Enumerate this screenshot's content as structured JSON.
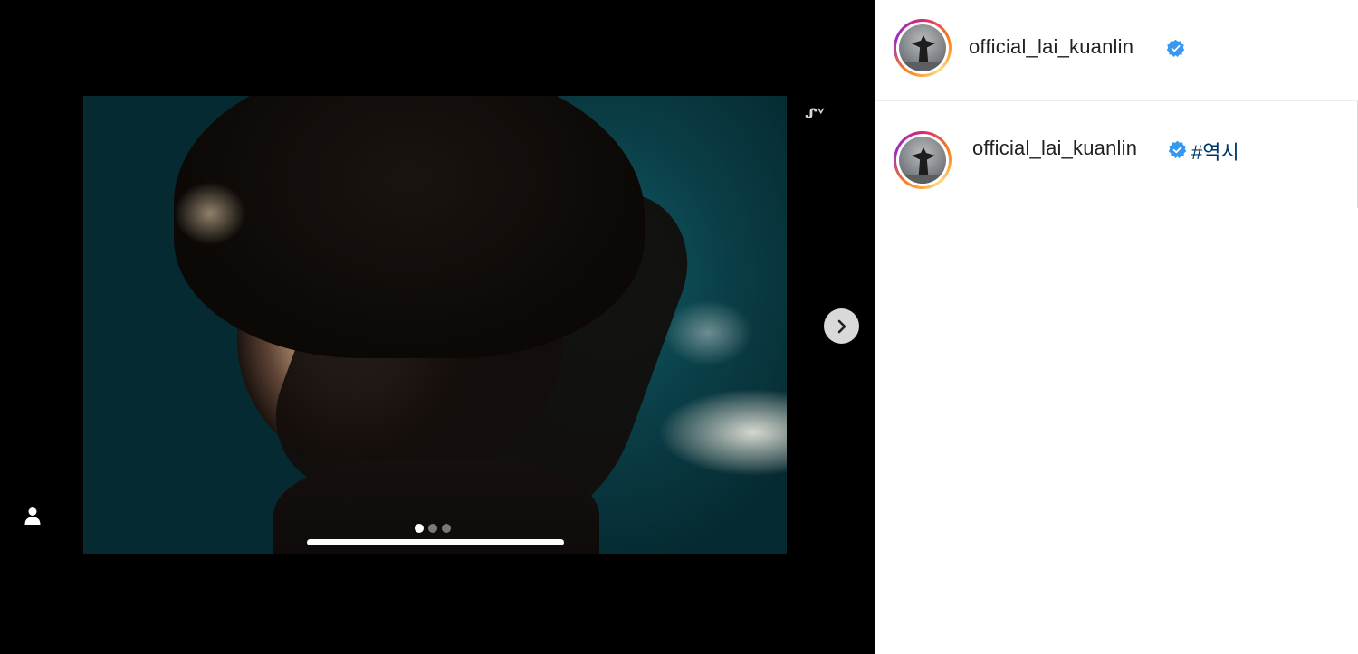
{
  "post": {
    "username": "official_lai_kuanlin",
    "caption_hashtag": "#역시",
    "carousel": {
      "slide_count": 3,
      "active_slide": 1,
      "corner_mark": "ᔑᘁ"
    }
  },
  "icons": {
    "verified": "verified-badge-icon",
    "next": "chevron-right-icon",
    "tag": "person-icon"
  },
  "colors": {
    "verified_blue": "#3897f0",
    "hashtag": "#00376b",
    "media_background": "#000000"
  }
}
